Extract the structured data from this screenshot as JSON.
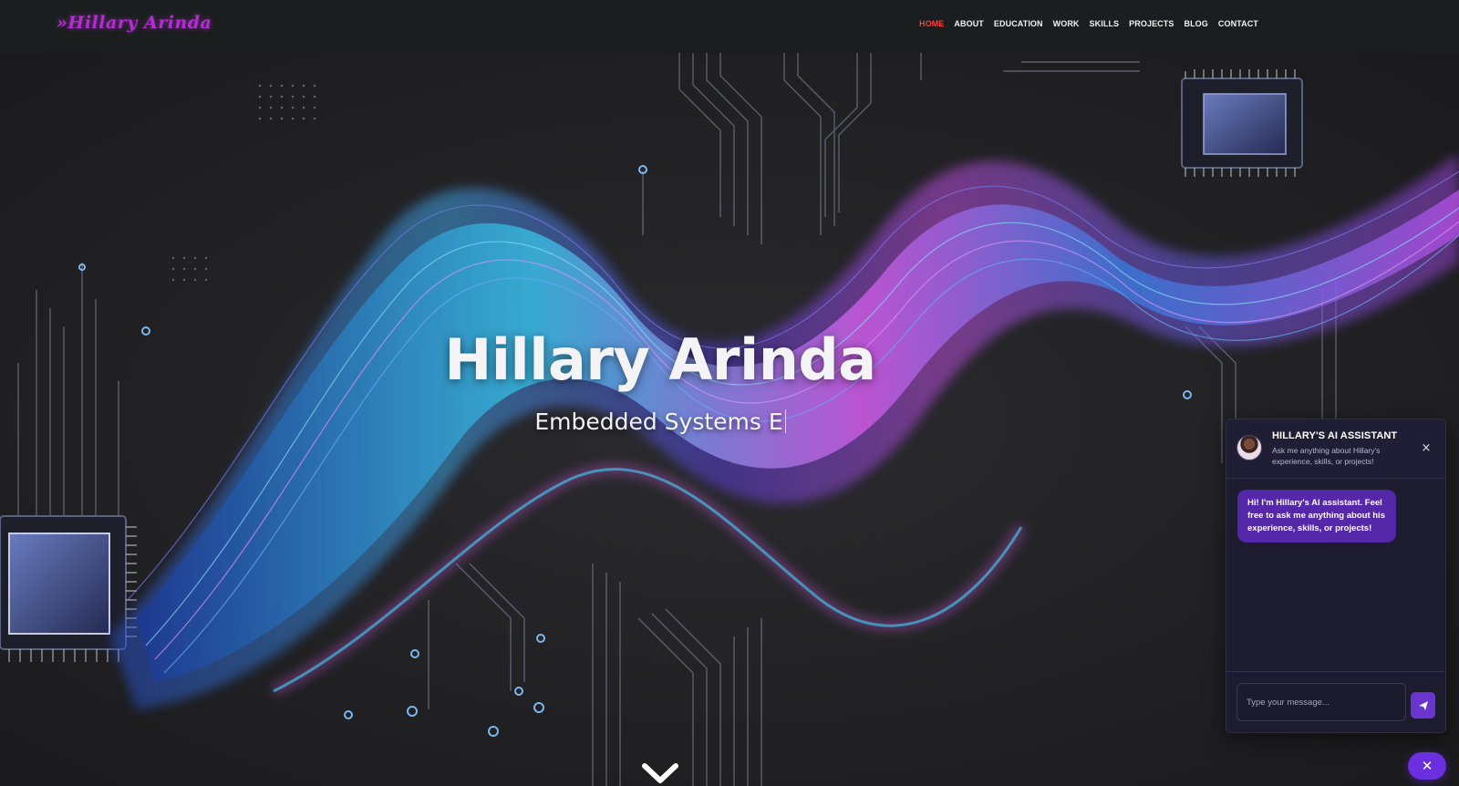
{
  "brand": {
    "logo_text": "»Hillary Arinda"
  },
  "nav": {
    "items": [
      {
        "label": "HOME",
        "active": true
      },
      {
        "label": "ABOUT"
      },
      {
        "label": "EDUCATION"
      },
      {
        "label": "WORK"
      },
      {
        "label": "SKILLS"
      },
      {
        "label": "PROJECTS"
      },
      {
        "label": "BLOG"
      },
      {
        "label": "CONTACT"
      }
    ]
  },
  "hero": {
    "title": "Hillary Arinda",
    "subtitle": "Embedded Systems E"
  },
  "chat": {
    "title": "HILLARY'S AI ASSISTANT",
    "description": "Ask me anything about Hillary's experience, skills, or projects!",
    "close_symbol": "×",
    "messages": [
      {
        "from": "bot",
        "text": "Hi! I'm Hillary's AI assistant. Feel free to ask me anything about his experience, skills, or projects!"
      }
    ],
    "input_placeholder": "Type your message...",
    "toggle_symbol": "✕"
  },
  "colors": {
    "nav_bg": "#1b1e1f",
    "brand": "#b52bd6",
    "nav_active": "#ff3b3b",
    "chat_accent": "#6a35cf",
    "bubble": "#5428a8"
  }
}
